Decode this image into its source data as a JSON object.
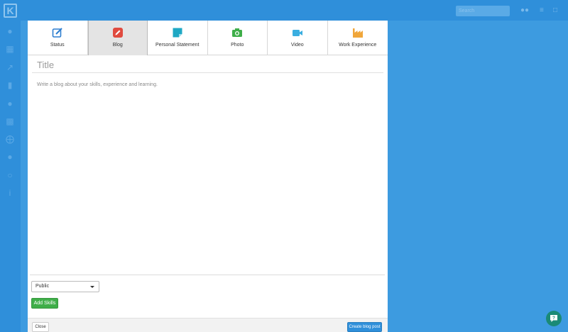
{
  "app": {
    "logo_letter": "K",
    "search_placeholder": "Search"
  },
  "tabs": [
    {
      "label": "Status",
      "icon": "edit-icon",
      "color": "#2f7fd0"
    },
    {
      "label": "Blog",
      "icon": "pencil-icon",
      "color": "#e04b3f"
    },
    {
      "label": "Personal Statement",
      "icon": "note-icon",
      "color": "#1fa8c4"
    },
    {
      "label": "Photo",
      "icon": "camera-icon",
      "color": "#3fae49"
    },
    {
      "label": "Video",
      "icon": "video-camera-icon",
      "color": "#3aaee0"
    },
    {
      "label": "Work Experience",
      "icon": "factory-icon",
      "color": "#f0a63a"
    }
  ],
  "editor": {
    "title_placeholder": "Title",
    "body_placeholder": "Write a blog about your skills, experience and learning."
  },
  "visibility": {
    "selected": "Public"
  },
  "buttons": {
    "add_skills": "Add Skills",
    "close": "Close",
    "create": "Create blog post"
  },
  "colors": {
    "background": "#3d9be0",
    "primary": "#2f8fda",
    "success": "#3fae49",
    "help": "#1a8a76"
  }
}
